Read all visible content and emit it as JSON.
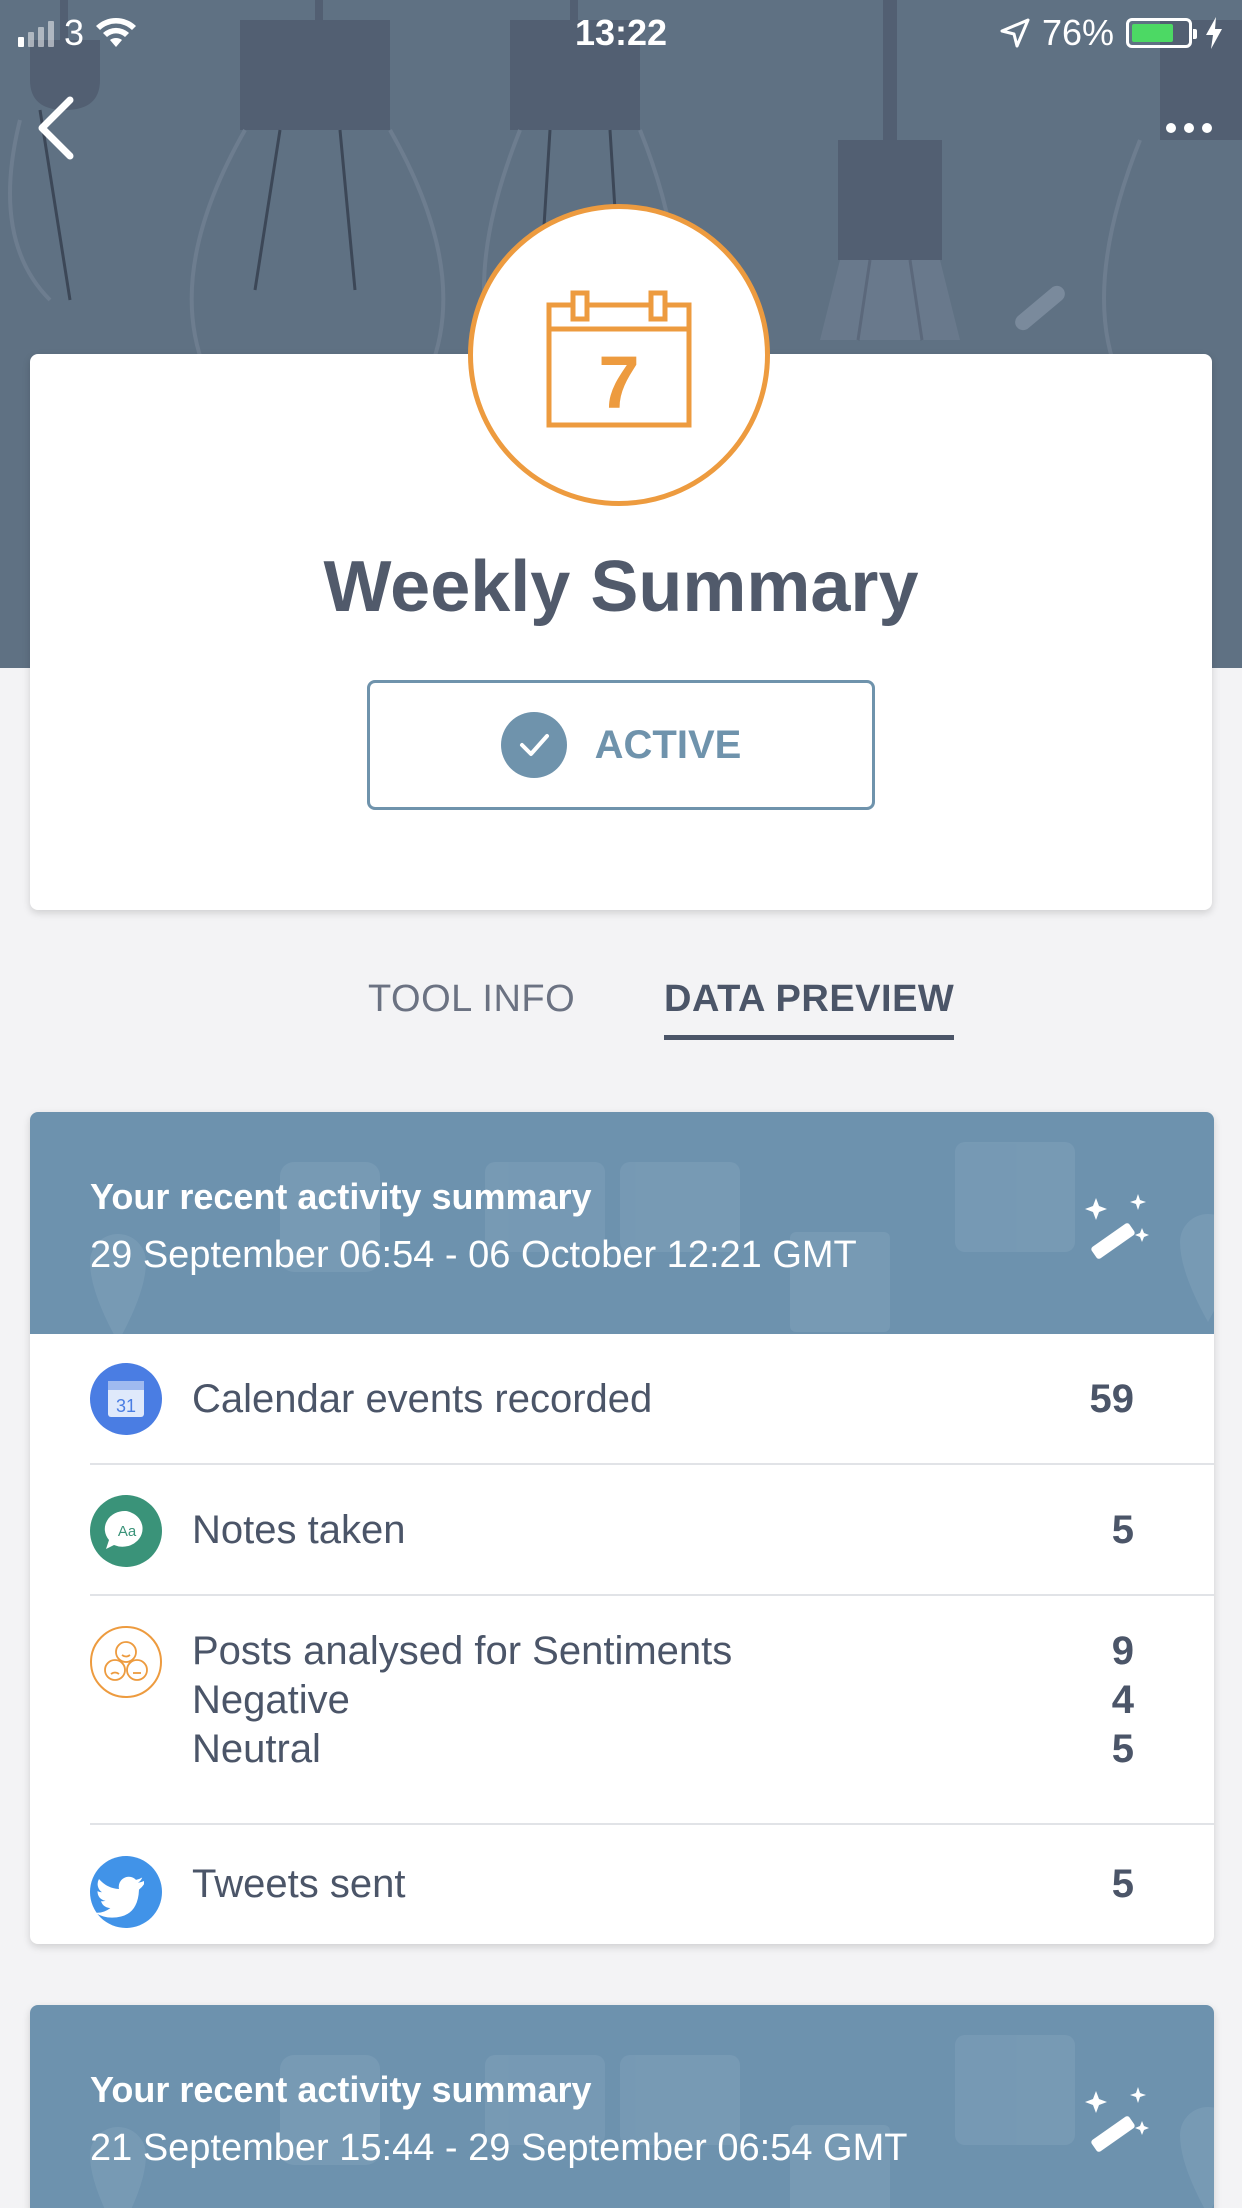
{
  "status_bar": {
    "carrier": "3",
    "time": "13:22",
    "battery": "76%"
  },
  "tool": {
    "icon_number": "7",
    "title": "Weekly Summary",
    "status_label": "ACTIVE"
  },
  "tabs": [
    {
      "label": "TOOL INFO",
      "active": false
    },
    {
      "label": "DATA PREVIEW",
      "active": true
    }
  ],
  "summaries": [
    {
      "title": "Your recent activity summary",
      "range": "29 September 06:54 - 06 October 12:21 GMT",
      "rows": [
        {
          "icon": "calendar-icon",
          "icon_text": "31",
          "label": "Calendar events recorded",
          "value": "59"
        },
        {
          "icon": "notes-icon",
          "icon_text": "Aa",
          "label": "Notes taken",
          "value": "5"
        },
        {
          "icon": "sentiment-icon",
          "label": "Posts analysed for Sentiments",
          "value": "9",
          "sub": [
            {
              "label": "Negative",
              "value": "4"
            },
            {
              "label": "Neutral",
              "value": "5"
            }
          ]
        },
        {
          "icon": "twitter-icon",
          "label": "Tweets sent",
          "value": "5"
        }
      ]
    },
    {
      "title": "Your recent activity summary",
      "range": "21 September 15:44 - 29 September 06:54 GMT"
    }
  ],
  "colors": {
    "header": "#5f7183",
    "accent_orange": "#ed9b3f",
    "card_header": "#6d92ae",
    "active_blue": "#6f93ac",
    "calendar_blue": "#4a7de3",
    "notes_green": "#3a9379",
    "twitter_blue": "#4193e8"
  }
}
